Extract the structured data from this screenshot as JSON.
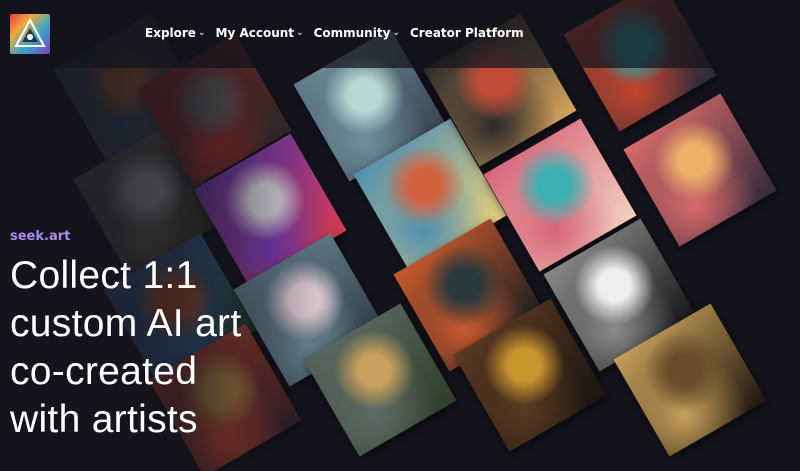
{
  "header": {
    "logo_icon": "seek-art-triangle-logo-icon",
    "nav": [
      {
        "label": "Explore",
        "has_dropdown": true
      },
      {
        "label": "My Account",
        "has_dropdown": true
      },
      {
        "label": "Community",
        "has_dropdown": true
      },
      {
        "label": "Creator Platform",
        "has_dropdown": false
      }
    ],
    "chevron_glyph": "⌄"
  },
  "hero": {
    "eyebrow": "seek.art",
    "headline": "Collect 1:1 custom AI art co-created with artists"
  },
  "gallery": {
    "artworks": [
      {
        "name": "feathered-warrior-artwork",
        "colors": [
          "#d9772b",
          "#3d6f8c",
          "#7a3b1e"
        ]
      },
      {
        "name": "marble-bust-artwork",
        "colors": [
          "#e7e3dc",
          "#8b7d6d",
          "#2a2620"
        ]
      },
      {
        "name": "autumn-lake-artwork",
        "colors": [
          "#e0622a",
          "#3a7bbd",
          "#1d3a26"
        ]
      },
      {
        "name": "masked-woman-artwork",
        "colors": [
          "#b98a3e",
          "#c7462e",
          "#2b1c25"
        ]
      },
      {
        "name": "stone-face-artwork",
        "colors": [
          "#6f6a66",
          "#b8322b",
          "#2f2c2a"
        ]
      },
      {
        "name": "ink-splash-artwork",
        "colors": [
          "#e9e4ee",
          "#7a3ec9",
          "#d13a4c"
        ]
      },
      {
        "name": "marble-swirl-artwork",
        "colors": [
          "#e5cfd8",
          "#6c8a97",
          "#2f3a45"
        ]
      },
      {
        "name": "storm-field-artwork",
        "colors": [
          "#c9a15c",
          "#5f6b66",
          "#2d3f28"
        ]
      },
      {
        "name": "crystal-artwork",
        "colors": [
          "#b9d8d4",
          "#6f8f9d",
          "#3a4552"
        ]
      },
      {
        "name": "blossom-headdress-artwork",
        "colors": [
          "#d4613e",
          "#4f8fb0",
          "#e8cf7a"
        ]
      },
      {
        "name": "dark-forest-artwork",
        "colors": [
          "#2a3a3c",
          "#c95a2e",
          "#141c20"
        ]
      },
      {
        "name": "gold-necklace-woman-artwork",
        "colors": [
          "#c9962e",
          "#5a3a22",
          "#1a1410"
        ]
      },
      {
        "name": "gothic-queen-artwork",
        "colors": [
          "#c24b37",
          "#2d2a2a",
          "#d5a45c"
        ]
      },
      {
        "name": "headphones-girl-artwork",
        "colors": [
          "#3ab0b3",
          "#d7657a",
          "#f1d0c0"
        ]
      },
      {
        "name": "afro-portrait-artwork",
        "colors": [
          "#efefef",
          "#8a8a8a",
          "#151515"
        ]
      },
      {
        "name": "jeweled-orb-artwork",
        "colors": [
          "#2fa3a0",
          "#c2462e",
          "#2b2a3a"
        ]
      },
      {
        "name": "golden-sunset-artwork",
        "colors": [
          "#f0b06a",
          "#d96b6a",
          "#322a3a"
        ]
      },
      {
        "name": "ornate-frame-artwork",
        "colors": [
          "#6b4b2a",
          "#c7a05a",
          "#20160f"
        ]
      }
    ]
  }
}
